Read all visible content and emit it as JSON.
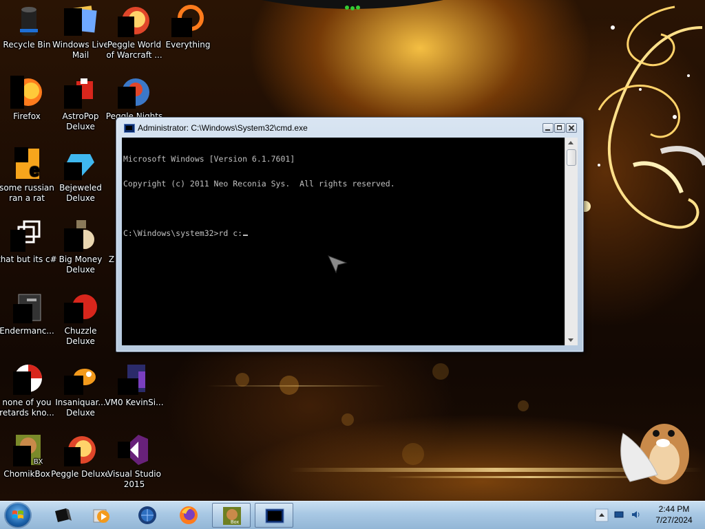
{
  "desktop": {
    "icons": [
      {
        "label": "Recycle Bin",
        "icon": "recycle-bin-icon"
      },
      {
        "label": "Windows Live Mail",
        "icon": "windows-live-mail-icon"
      },
      {
        "label": "Peggle World of Warcraft ...",
        "icon": "peggle-wow-icon"
      },
      {
        "label": "Everything",
        "icon": "everything-icon"
      },
      {
        "label": "Firefox",
        "icon": "firefox-icon"
      },
      {
        "label": "AstroPop Deluxe",
        "icon": "astropop-icon"
      },
      {
        "label": "Peggle Nights",
        "icon": "peggle-nights-icon"
      },
      {
        "label": "some russian ran a rat",
        "icon": "russian-rat-icon"
      },
      {
        "label": "Bejeweled Deluxe",
        "icon": "bejeweled-icon"
      },
      {
        "label": "that but its c#",
        "icon": "shortcut-icon"
      },
      {
        "label": "Big Money Deluxe",
        "icon": "big-money-icon"
      },
      {
        "label": "Z",
        "icon": "zuma-icon"
      },
      {
        "label": "Endermanc...",
        "icon": "endermanch-icon"
      },
      {
        "label": "Chuzzle Deluxe",
        "icon": "chuzzle-icon"
      },
      {
        "label": "none of you retards kno...",
        "icon": "chrome-icon"
      },
      {
        "label": "Insaniquar... Deluxe",
        "icon": "insaniquarium-icon"
      },
      {
        "label": "VM0 KevinSi...",
        "icon": "vm-icon"
      },
      {
        "label": "ChomikBox",
        "icon": "chomikbox-icon"
      },
      {
        "label": "Peggle Deluxe",
        "icon": "peggle-deluxe-icon"
      },
      {
        "label": "Visual Studio 2015",
        "icon": "visual-studio-icon"
      }
    ]
  },
  "cmd": {
    "title": "Administrator: C:\\Windows\\System32\\cmd.exe",
    "lines": [
      "Microsoft Windows [Version 6.1.7601]",
      "Copyright (c) 2011 Neo Reconia Sys.  All rights reserved.",
      "",
      "C:\\Windows\\system32>rd c:"
    ]
  },
  "taskbar": {
    "start": "start-orb-icon",
    "pinned": [
      "cmd-like-icon",
      "media-player-icon",
      "globe-icon",
      "firefox-icon",
      "chomikbox-icon",
      "cmd-icon"
    ],
    "clock": {
      "time": "2:44 PM",
      "date": "7/27/2024"
    }
  },
  "colors": {
    "taskbar": "#a8c8e4",
    "console_bg": "#000000",
    "console_fg": "#c0c0c0",
    "wallpaper_accent": "#f4b23a"
  }
}
